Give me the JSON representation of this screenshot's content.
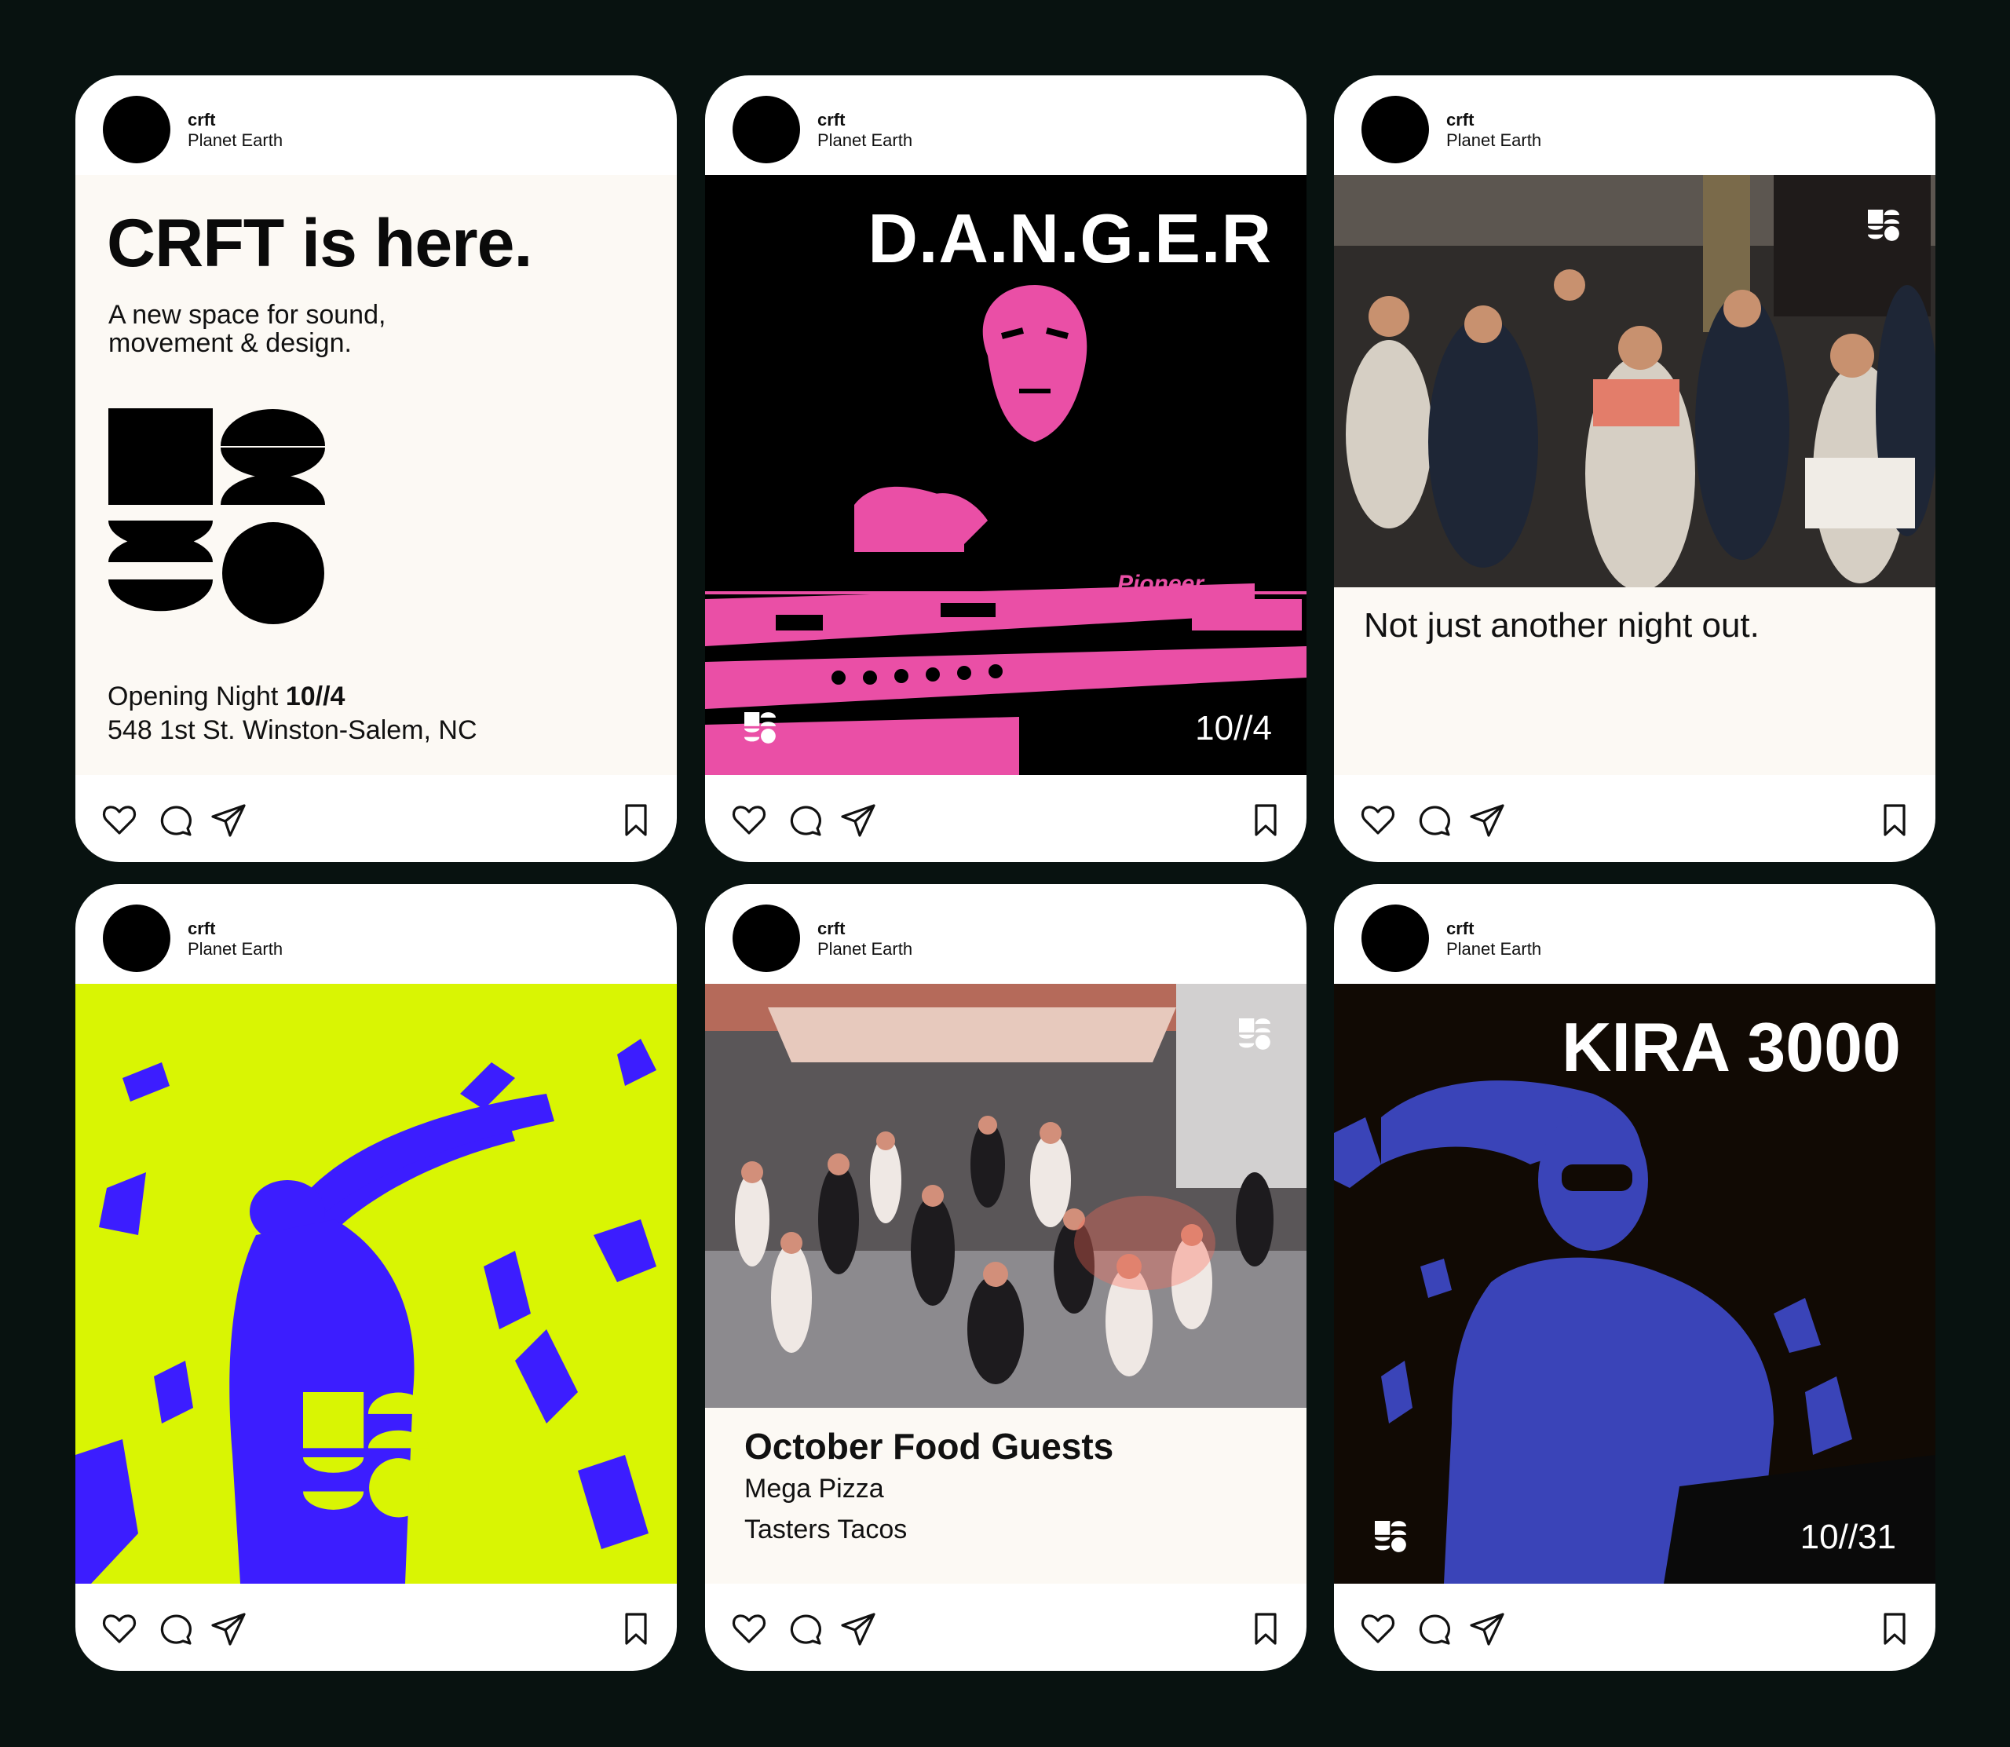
{
  "posts": [
    {
      "account": "crft",
      "location": "Planet Earth",
      "headline": "CRFT is here.",
      "subtitle": "A new space for sound, movement & design.",
      "opening_label": "Opening Night",
      "opening_date": "10//4",
      "address": "548 1st St. Winston-Salem, NC"
    },
    {
      "account": "crft",
      "location": "Planet Earth",
      "title": "D.A.N.G.E.R",
      "date": "10//4",
      "photo_text": "Pioneer"
    },
    {
      "account": "crft",
      "location": "Planet Earth",
      "caption": "Not just another night out."
    },
    {
      "account": "crft",
      "location": "Planet Earth"
    },
    {
      "account": "crft",
      "location": "Planet Earth",
      "title": "October Food Guests",
      "items": [
        "Mega Pizza",
        "Tasters Tacos"
      ]
    },
    {
      "account": "crft",
      "location": "Planet Earth",
      "title": "KIRA 3000",
      "date": "10//31"
    }
  ],
  "colors": {
    "background": "#081210",
    "card": "#ffffff",
    "cream": "#fcf9f4",
    "danger_pink": "#ea4fa6",
    "lime": "#d9f503",
    "blue": "#3c1dff",
    "kira_blue": "#3a44b8",
    "kira_bg": "#110a04"
  },
  "icons": [
    "heart-icon",
    "comment-icon",
    "share-icon",
    "bookmark-icon",
    "crft-logo-icon"
  ]
}
